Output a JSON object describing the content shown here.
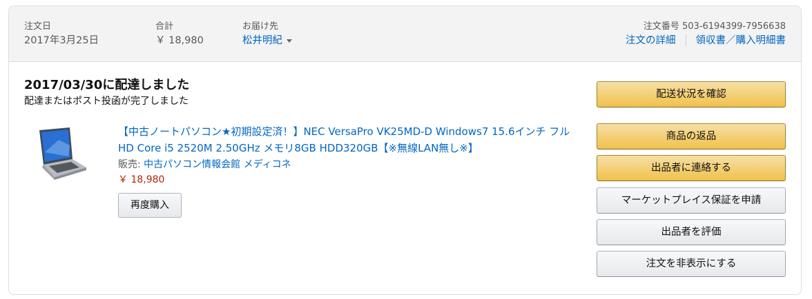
{
  "header": {
    "order_date_label": "注文日",
    "order_date": "2017年3月25日",
    "total_label": "合計",
    "total": "￥ 18,980",
    "ship_to_label": "お届け先",
    "ship_to": "松井明紀",
    "order_number_label": "注文番号",
    "order_number": "503-6194399-7956638",
    "details_link": "注文の詳細",
    "receipt_link": "領収書／購入明細書"
  },
  "shipment": {
    "status_title": "2017/03/30に配達しました",
    "status_sub": "配達またはポスト投函が完了しました"
  },
  "item": {
    "image_icon": "laptop-product-image",
    "title": "【中古ノートパソコン★初期設定済！】NEC VersaPro VK25MD-D Windows7 15.6インチ フルHD Core i5 2520M 2.50GHz メモリ8GB HDD320GB【※無線LAN無し※】",
    "seller_label": "販売: ",
    "seller_name": "中古パソコン情報会館 メディコネ",
    "price": "￥ 18,980",
    "rebuy_label": "再度購入"
  },
  "actions": [
    {
      "label": "配送状況を確認",
      "style": "yellow"
    },
    {
      "label": "商品の返品",
      "style": "yellow"
    },
    {
      "label": "出品者に連絡する",
      "style": "yellow"
    },
    {
      "label": "マーケットプレイス保証を申請",
      "style": "gray"
    },
    {
      "label": "出品者を評価",
      "style": "gray"
    },
    {
      "label": "注文を非表示にする",
      "style": "gray"
    }
  ],
  "colors": {
    "link": "#0066c0",
    "price": "#b12704",
    "header_bg": "#f3f3f3",
    "button_yellow": "#f0c14b"
  }
}
